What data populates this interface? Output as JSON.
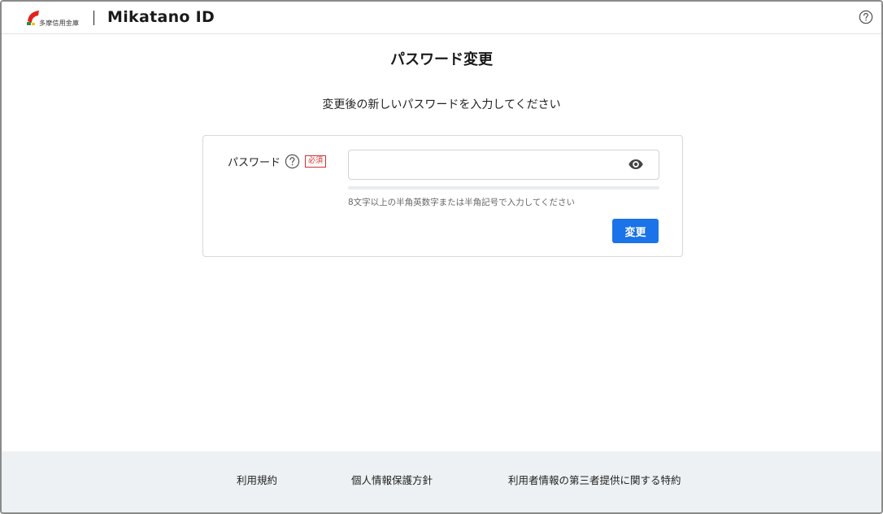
{
  "header": {
    "bank_name": "多摩信用金庫",
    "brand": "Mikatano ID",
    "help_icon": "question-circle-icon"
  },
  "main": {
    "title": "パスワード変更",
    "instruction": "変更後の新しいパスワードを入力してください"
  },
  "form": {
    "password_label": "パスワード",
    "required_badge": "必須",
    "password_value": "",
    "password_placeholder": "",
    "strength_percent": 0,
    "hint": "8文字以上の半角英数字または半角記号で入力してください",
    "submit_label": "変更",
    "eye_icon": "eye-icon"
  },
  "footer": {
    "links": [
      "利用規約",
      "個人情報保護方針",
      "利用者情報の第三者提供に関する特約"
    ]
  },
  "colors": {
    "primary": "#1a73e8",
    "required": "#d03030",
    "footer_bg": "#eef1f3"
  }
}
